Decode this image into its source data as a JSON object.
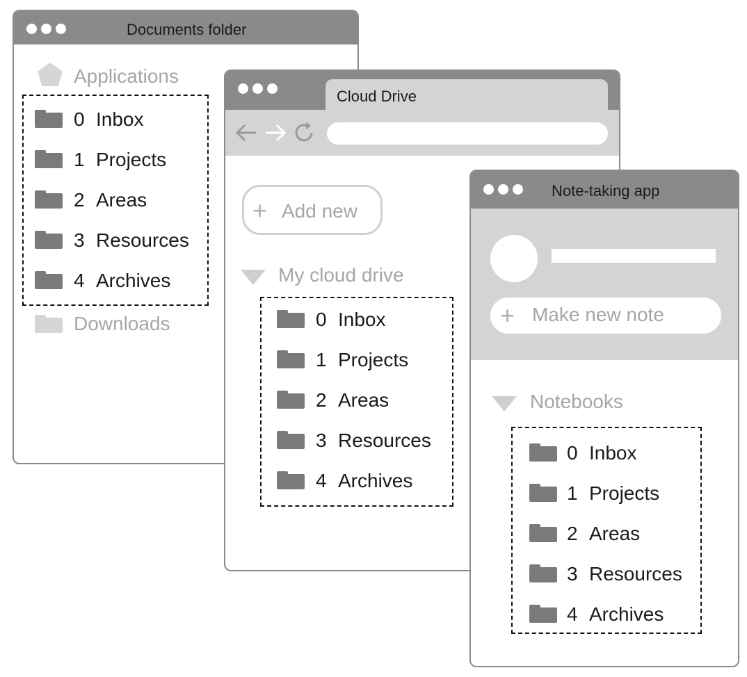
{
  "documents_window": {
    "title": "Documents folder",
    "applications_label": "Applications",
    "downloads_label": "Downloads",
    "items": [
      {
        "num": "0",
        "label": "Inbox"
      },
      {
        "num": "1",
        "label": "Projects"
      },
      {
        "num": "2",
        "label": "Areas"
      },
      {
        "num": "3",
        "label": "Resources"
      },
      {
        "num": "4",
        "label": "Archives"
      }
    ]
  },
  "cloud_window": {
    "tab_title": "Cloud Drive",
    "add_new_label": "Add new",
    "section_label": "My cloud drive",
    "items": [
      {
        "num": "0",
        "label": "Inbox"
      },
      {
        "num": "1",
        "label": "Projects"
      },
      {
        "num": "2",
        "label": "Areas"
      },
      {
        "num": "3",
        "label": "Resources"
      },
      {
        "num": "4",
        "label": "Archives"
      }
    ]
  },
  "notes_window": {
    "title": "Note-taking app",
    "make_note_label": "Make new note",
    "section_label": "Notebooks",
    "items": [
      {
        "num": "0",
        "label": "Inbox"
      },
      {
        "num": "1",
        "label": "Projects"
      },
      {
        "num": "2",
        "label": "Areas"
      },
      {
        "num": "3",
        "label": "Resources"
      },
      {
        "num": "4",
        "label": "Archives"
      }
    ]
  },
  "colors": {
    "titlebar": "#8a8a8a",
    "folder": "#7a7a7a",
    "dim_text": "#a6a6a6",
    "panel_gray": "#d4d4d4"
  }
}
